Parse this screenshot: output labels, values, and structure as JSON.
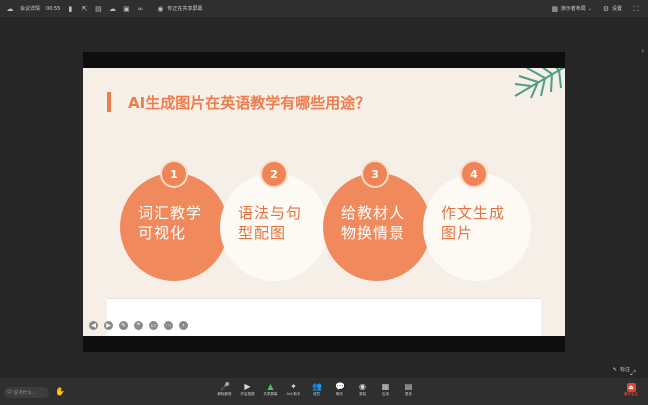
{
  "topbar": {
    "app_name": "会议详情",
    "time": "00:55",
    "notice": "你正在共享屏幕",
    "present_label": "演示者布局",
    "settings_label": "设置"
  },
  "slide": {
    "title": "AI生成图片在英语教学有哪些用途？",
    "circles": [
      {
        "num": "1",
        "line1": "词汇教学",
        "line2": "可视化"
      },
      {
        "num": "2",
        "line1": "语法与句",
        "line2": "型配图"
      },
      {
        "num": "3",
        "line1": "给教材人",
        "line2": "物换情景"
      },
      {
        "num": "4",
        "line1": "作文生成",
        "line2": "图片"
      }
    ]
  },
  "stage": {
    "stop_annotation": "标注"
  },
  "bottombar": {
    "say_placeholder": "说点什么...",
    "buttons": [
      {
        "icon": "mic-icon",
        "label": "解除静音"
      },
      {
        "icon": "video-icon",
        "label": "开启视频"
      },
      {
        "icon": "share-screen-icon",
        "label": "共享屏幕"
      },
      {
        "icon": "ai-icon",
        "label": "AI小助手"
      },
      {
        "icon": "members-icon",
        "label": "成员"
      },
      {
        "icon": "chat-icon",
        "label": "聊天"
      },
      {
        "icon": "record-icon",
        "label": "录制"
      },
      {
        "icon": "apps-icon",
        "label": "应用"
      },
      {
        "icon": "more-icon",
        "label": "更多"
      }
    ],
    "end_label": "离开会议"
  }
}
